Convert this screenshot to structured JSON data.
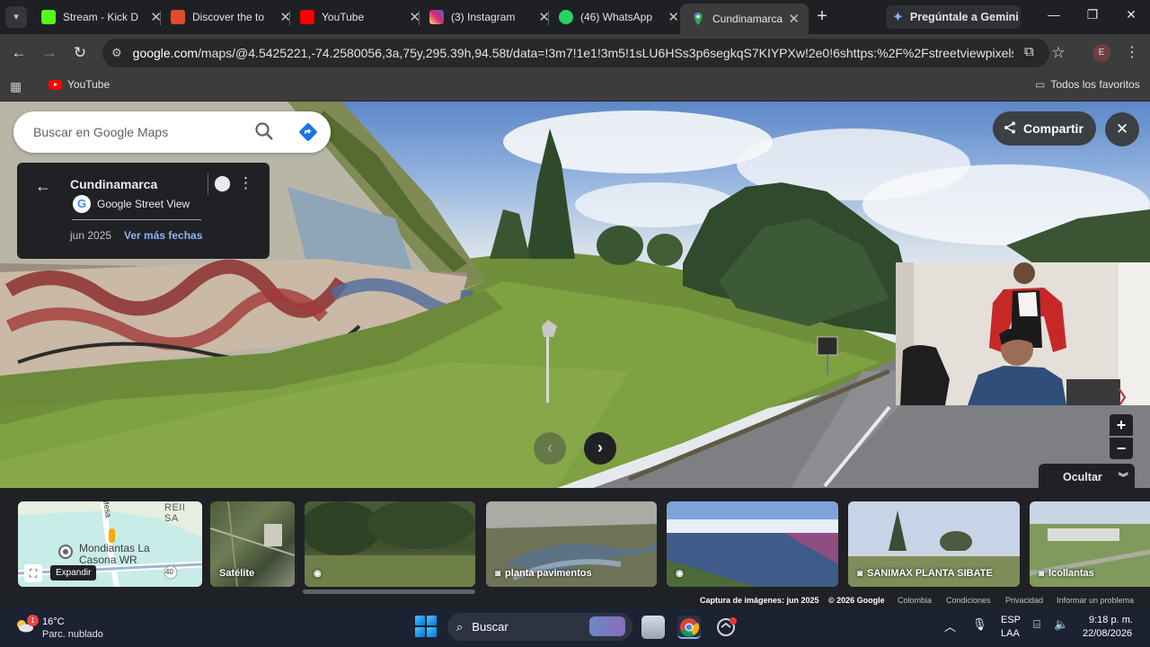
{
  "browser": {
    "tabs": [
      {
        "title": "Stream - Kick D",
        "favicon": "kick-icon",
        "color": "#53fc18",
        "active": false
      },
      {
        "title": "Discover the to",
        "favicon": "discover-icon",
        "color": "#e14d2a",
        "active": false
      },
      {
        "title": "YouTube",
        "favicon": "youtube-icon",
        "color": "#ff0000",
        "active": false
      },
      {
        "title": "(3) Instagram",
        "favicon": "instagram-icon",
        "color": "#d62976",
        "active": false
      },
      {
        "title": "(46) WhatsApp",
        "favicon": "whatsapp-icon",
        "color": "#25d366",
        "active": false
      },
      {
        "title": "Cundinamarca",
        "favicon": "maps-icon",
        "color": "#34a853",
        "active": true
      }
    ],
    "gemini_label": "Pregúntale a Gemini",
    "url_host": "google.com",
    "url_rest": "/maps/@4.5425221,-74.2580056,3a,75y,295.39h,94.58t/data=!3m7!1e1!3m5!1sLU6HSs3p6segkqS7KIYPXw!2e0!6shttps:%2F%2Fstreetviewpixels-pa.googleap...",
    "avatar_letter": "E",
    "bookmarks": {
      "youtube": "YouTube",
      "all": "Todos los favoritos"
    }
  },
  "maps": {
    "search_placeholder": "Buscar en Google Maps",
    "place_title": "Cundinamarca",
    "provider": "Google Street View",
    "capture_date": "jun 2025",
    "more_dates": "Ver más fechas",
    "share_label": "Compartir",
    "hide_label": "Ocultar",
    "zoom_in": "+",
    "zoom_out": "−",
    "minimap_expand": "Expandir",
    "minimap_labels": {
      "road": "Mesa",
      "place": "Mondiantas La Casona WR",
      "top": "REII SA",
      "route": "40"
    },
    "thumbnails": [
      {
        "label": "Satélite",
        "icon": "",
        "kind": "satellite"
      },
      {
        "label": "",
        "icon": "360-icon",
        "kind": "trees"
      },
      {
        "label": "planta pavimentos",
        "icon": "camera-icon",
        "kind": "lake"
      },
      {
        "label": "",
        "icon": "360-icon",
        "kind": "reservoir"
      },
      {
        "label": "SANIMAX PLANTA SIBATE",
        "icon": "camera-icon",
        "kind": "plant"
      },
      {
        "label": "Icollantas",
        "icon": "camera-icon",
        "kind": "factory"
      }
    ],
    "footer": {
      "capture": "Captura de imágenes: jun 2025",
      "copyright": "© 2026 Google",
      "country": "Colombia",
      "terms": "Condiciones",
      "privacy": "Privacidad",
      "report": "Informar un problema"
    }
  },
  "taskbar": {
    "weather_temp": "16°C",
    "weather_desc": "Parc. nublado",
    "weather_badge": "1",
    "search_placeholder": "Buscar",
    "lang_top": "ESP",
    "lang_bottom": "LAA",
    "time": "9:18 p. m.",
    "date": "22/08/2026"
  }
}
